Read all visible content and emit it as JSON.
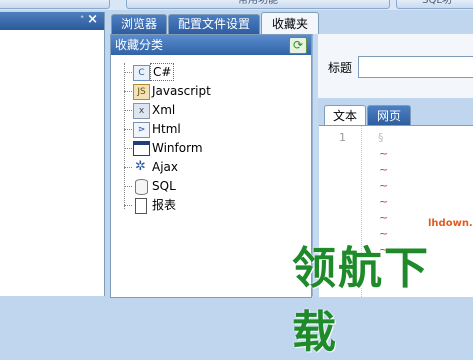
{
  "ribbon": {
    "tabs": [
      "",
      "常用功能",
      "SQL功"
    ]
  },
  "left_pane": {
    "pin_glyph": "ᐩ",
    "close_glyph": "×"
  },
  "main_tabs": [
    {
      "label": "浏览器",
      "active": false
    },
    {
      "label": "配置文件设置",
      "active": false
    },
    {
      "label": "收藏夹",
      "active": true
    }
  ],
  "favorites": {
    "header": "收藏分类",
    "refresh_icon": "refresh-icon",
    "items": [
      {
        "label": "C#",
        "icon": "csharp-icon",
        "selected": true
      },
      {
        "label": "Javascript",
        "icon": "javascript-icon",
        "selected": false
      },
      {
        "label": "Xml",
        "icon": "xml-icon",
        "selected": false
      },
      {
        "label": "Html",
        "icon": "html-icon",
        "selected": false
      },
      {
        "label": "Winform",
        "icon": "winform-icon",
        "selected": false
      },
      {
        "label": "Ajax",
        "icon": "ajax-icon",
        "selected": false
      },
      {
        "label": "SQL",
        "icon": "sql-icon",
        "selected": false
      },
      {
        "label": "报表",
        "icon": "report-icon",
        "selected": false
      }
    ]
  },
  "details": {
    "title_label": "标题",
    "title_value": ""
  },
  "sub_tabs": [
    {
      "label": "文本",
      "active": true
    },
    {
      "label": "网页",
      "active": false
    }
  ],
  "editor": {
    "line_number": "1",
    "tilde": "~"
  },
  "watermark": {
    "text": "领航下载",
    "domain": "lhdown.com"
  },
  "colors": {
    "tab_blue": "#2d5d9f",
    "watermark_green": "#1f8a2a",
    "tilde_red": "#d03a2a"
  }
}
